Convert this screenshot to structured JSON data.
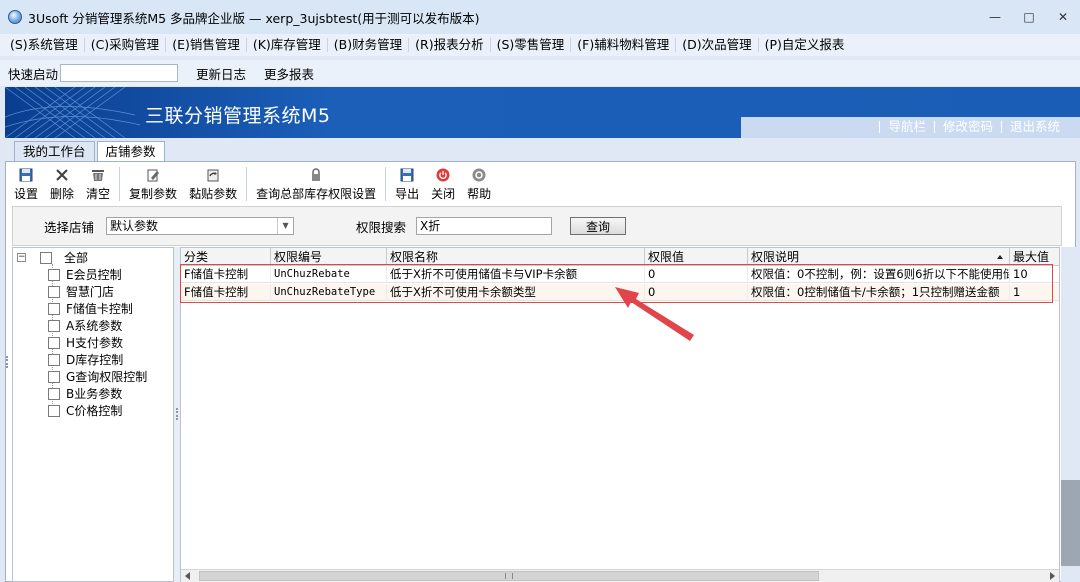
{
  "window": {
    "title": "3Usoft 分销管理系统M5 多品牌企业版 — xerp_3ujsbtest(用于测可以发布版本)",
    "controls": [
      "—",
      "□",
      "✕"
    ]
  },
  "menu": [
    "(S)系统管理",
    "(C)采购管理",
    "(E)销售管理",
    "(K)库存管理",
    "(B)财务管理",
    "(R)报表分析",
    "(S)零售管理",
    "(F)辅料物料管理",
    "(D)次品管理",
    "(P)自定义报表"
  ],
  "quickbar": {
    "label": "快速启动",
    "input_value": "",
    "links": [
      "更新日志",
      "更多报表"
    ]
  },
  "banner": {
    "title": "三联分销管理系统M5",
    "links": [
      "导航栏",
      "修改密码",
      "退出系统"
    ]
  },
  "tabs": [
    {
      "label": "我的工作台",
      "active": false
    },
    {
      "label": "店铺参数",
      "active": true
    }
  ],
  "toolbar": [
    {
      "label": "设置",
      "icon": "save-icon"
    },
    {
      "label": "删除",
      "icon": "delete-icon"
    },
    {
      "label": "清空",
      "icon": "clear-icon"
    },
    {
      "label": "复制参数",
      "icon": "copy-icon"
    },
    {
      "label": "黏贴参数",
      "icon": "paste-icon"
    },
    {
      "label": "查询总部库存权限设置",
      "icon": "lock-icon"
    },
    {
      "label": "导出",
      "icon": "export-icon"
    },
    {
      "label": "关闭",
      "icon": "power-icon"
    },
    {
      "label": "帮助",
      "icon": "help-icon"
    }
  ],
  "filter": {
    "shop_label": "选择店铺",
    "shop_value": "默认参数",
    "search_label": "权限搜索",
    "search_value": "X折",
    "query_button": "查询"
  },
  "tree": {
    "root": "全部",
    "items": [
      "E会员控制",
      "智慧门店",
      "F储值卡控制",
      "A系统参数",
      "H支付参数",
      "D库存控制",
      "G查询权限控制",
      "B业务参数",
      "C价格控制"
    ]
  },
  "grid": {
    "headers": [
      "分类",
      "权限编号",
      "权限名称",
      "权限值",
      "权限说明",
      "最大值"
    ],
    "rows": [
      [
        "F储值卡控制",
        "UnChuzRebate",
        "低于X折不可使用储值卡与VIP卡余额",
        "0",
        "权限值：0不控制，例：设置6则6折以下不能使用储",
        "10"
      ],
      [
        "F储值卡控制",
        "UnChuzRebateType",
        "低于X折不可使用卡余额类型",
        "0",
        "权限值：0控制储值卡/卡余额；1只控制赠送金额",
        "1"
      ]
    ]
  },
  "colors": {
    "banner": "#1a5db6",
    "highlight": "#e0454b"
  }
}
